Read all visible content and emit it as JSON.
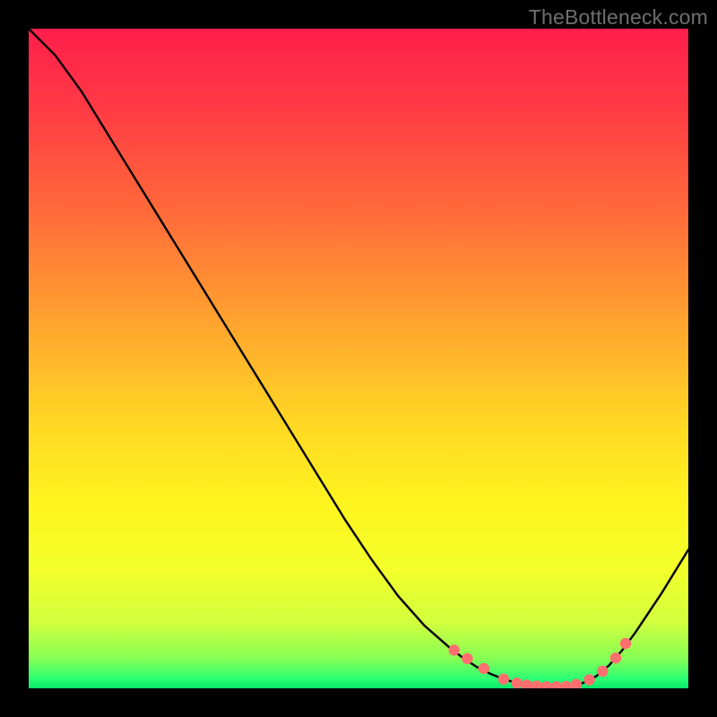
{
  "watermark": "TheBottleneck.com",
  "chart_data": {
    "type": "line",
    "title": "",
    "xlabel": "",
    "ylabel": "",
    "xlim": [
      0,
      100
    ],
    "ylim": [
      0,
      100
    ],
    "series": [
      {
        "name": "curve",
        "x": [
          0,
          4,
          8,
          12,
          16,
          20,
          24,
          28,
          32,
          36,
          40,
          44,
          48,
          52,
          56,
          60,
          64,
          66,
          68,
          70,
          72,
          74,
          76,
          78,
          80,
          82,
          84,
          86,
          88,
          90,
          92,
          96,
          100
        ],
        "y": [
          100,
          96,
          90.5,
          84,
          77.5,
          71,
          64.5,
          58,
          51.5,
          45,
          38.5,
          32,
          25.5,
          19.5,
          14,
          9.5,
          6,
          4.5,
          3.2,
          2.2,
          1.4,
          0.8,
          0.4,
          0.2,
          0.2,
          0.3,
          0.8,
          1.8,
          3.5,
          5.8,
          8.5,
          14.5,
          21
        ]
      }
    ],
    "markers": {
      "name": "highlight-dots",
      "x": [
        64.5,
        66.5,
        69,
        72,
        74,
        75.5,
        77,
        78.5,
        80,
        81.5,
        83,
        85,
        87,
        89,
        90.5
      ],
      "y": [
        5.8,
        4.5,
        3.0,
        1.4,
        0.8,
        0.5,
        0.35,
        0.25,
        0.25,
        0.3,
        0.6,
        1.3,
        2.6,
        4.6,
        6.8
      ]
    },
    "gradient_stops": [
      {
        "offset": 0.0,
        "color": "#ff1e4c"
      },
      {
        "offset": 0.12,
        "color": "#ff3a44"
      },
      {
        "offset": 0.28,
        "color": "#ff6b3a"
      },
      {
        "offset": 0.45,
        "color": "#ffa52e"
      },
      {
        "offset": 0.6,
        "color": "#ffd823"
      },
      {
        "offset": 0.72,
        "color": "#fef41f"
      },
      {
        "offset": 0.82,
        "color": "#f3ff2a"
      },
      {
        "offset": 0.9,
        "color": "#d2ff3e"
      },
      {
        "offset": 0.955,
        "color": "#86ff55"
      },
      {
        "offset": 0.985,
        "color": "#2dff72"
      },
      {
        "offset": 1.0,
        "color": "#08e66a"
      }
    ],
    "marker_color": "#ff6f6f",
    "line_color": "#000000"
  }
}
